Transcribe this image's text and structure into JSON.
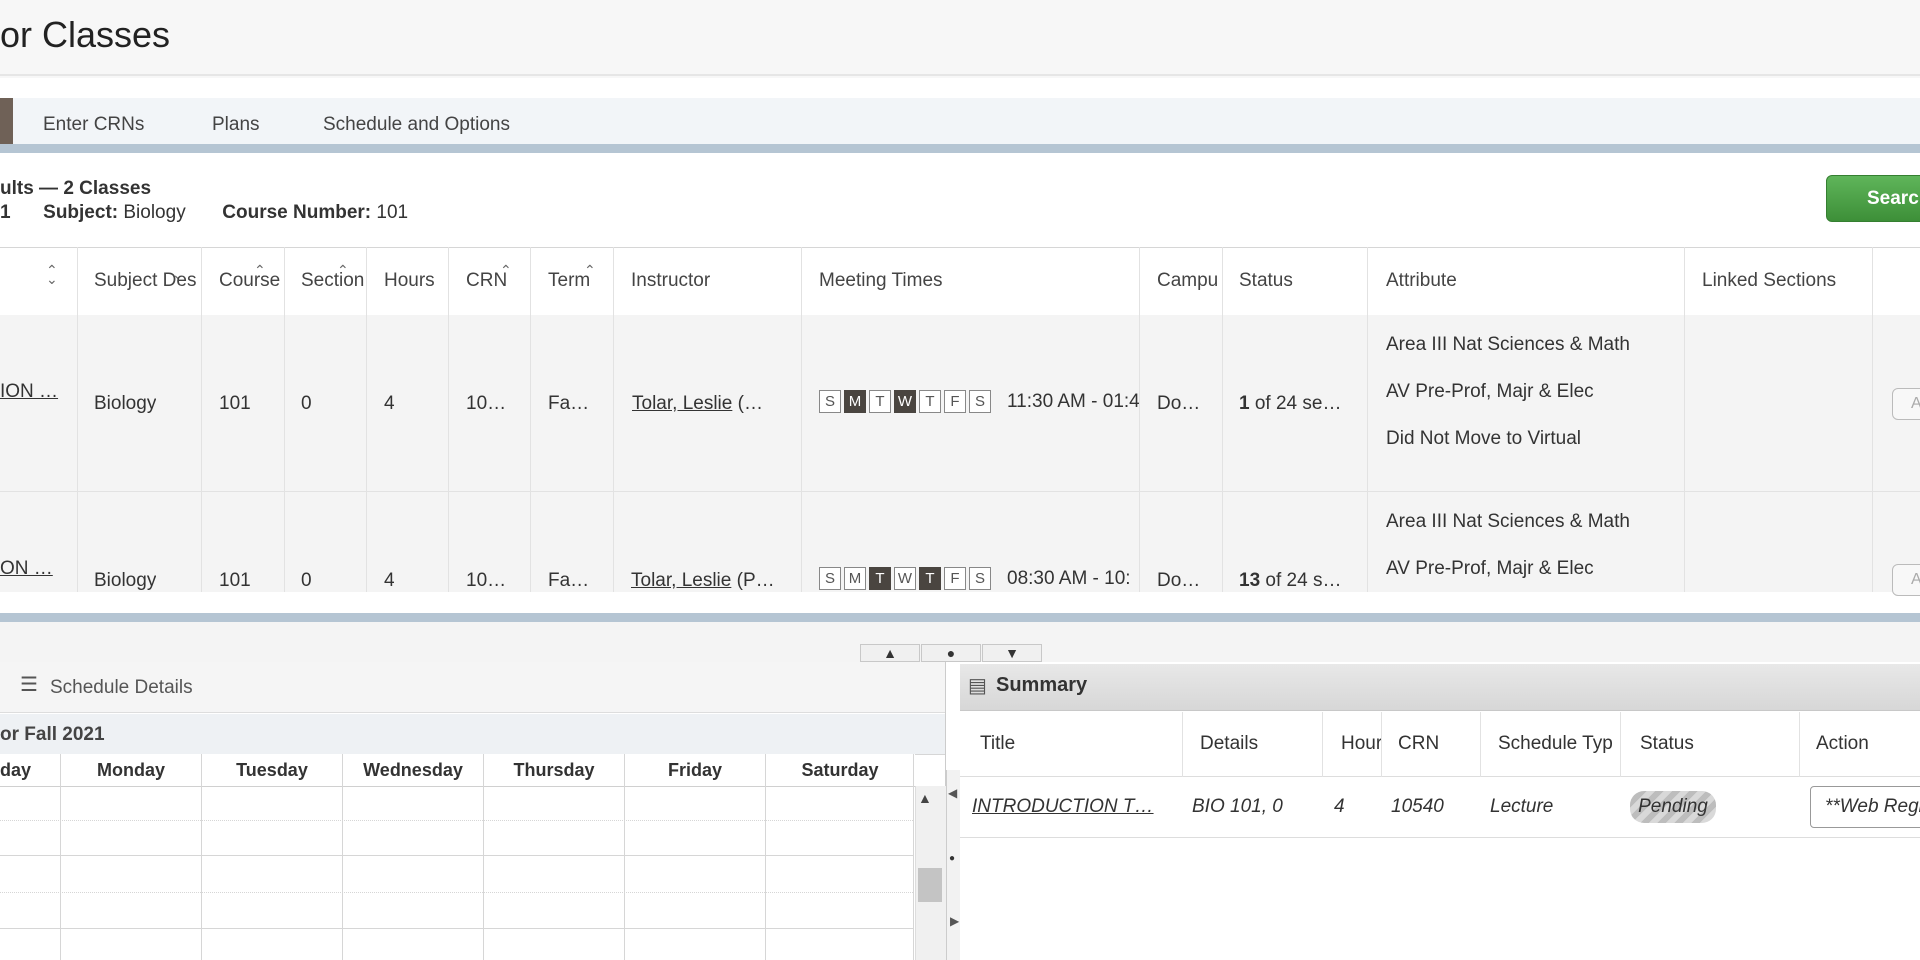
{
  "page": {
    "title": "or Classes"
  },
  "tabs": [
    {
      "label": "Enter CRNs"
    },
    {
      "label": "Plans"
    },
    {
      "label": "Schedule and Options"
    }
  ],
  "results": {
    "title": "ults — 2 Classes",
    "term_fragment": "1",
    "subject_label": "Subject:",
    "subject_value": "Biology",
    "course_number_label": "Course Number:",
    "course_number_value": "101",
    "search_button": "Searc"
  },
  "grid": {
    "columns": [
      "Subject Des",
      "Course",
      "Section",
      "Hours",
      "CRN",
      "Term",
      "Instructor",
      "Meeting Times",
      "Campu",
      "Status",
      "Attribute",
      "Linked Sections"
    ],
    "rows": [
      {
        "title": "ION …",
        "subject": "Biology",
        "course": "101",
        "section": "0",
        "hours": "4",
        "crn": "10…",
        "term": "Fa…",
        "instructor_link": "Tolar, Leslie",
        "instructor_rest": "(…",
        "days": [
          "S",
          "M",
          "T",
          "W",
          "T",
          "F",
          "S"
        ],
        "days_on": [
          false,
          true,
          false,
          true,
          false,
          false,
          false
        ],
        "time": "11:30 AM - 01:4",
        "campus": "Do…",
        "status_bold": "1",
        "status_rest": " of 24 se…",
        "attributes": [
          "Area III Nat Sciences & Math",
          "AV Pre-Prof, Majr & Elec",
          "Did Not Move to Virtual"
        ],
        "action_stub": "A"
      },
      {
        "title": "ON …",
        "subject": "Biology",
        "course": "101",
        "section": "0",
        "hours": "4",
        "crn": "10…",
        "term": "Fa…",
        "instructor_link": "Tolar, Leslie",
        "instructor_rest": "(P…",
        "days": [
          "S",
          "M",
          "T",
          "W",
          "T",
          "F",
          "S"
        ],
        "days_on": [
          false,
          false,
          true,
          false,
          true,
          false,
          false
        ],
        "time": "08:30 AM - 10:",
        "campus": "Do…",
        "status_bold": "13",
        "status_rest": " of 24 s…",
        "attributes": [
          "Area III Nat Sciences & Math",
          "AV Pre-Prof, Majr & Elec"
        ],
        "action_stub": "A"
      }
    ]
  },
  "schedule": {
    "tab_label": "Schedule Details",
    "term_label": "or Fall 2021",
    "weekdays": [
      "day",
      "Monday",
      "Tuesday",
      "Wednesday",
      "Thursday",
      "Friday",
      "Saturday"
    ]
  },
  "summary": {
    "title": "Summary",
    "columns": [
      "Title",
      "Details",
      "Hour",
      "CRN",
      "Schedule Typ",
      "Status",
      "Action"
    ],
    "row": {
      "title": "INTRODUCTION T…",
      "details": "BIO 101, 0",
      "hours": "4",
      "crn": "10540",
      "schedule_type": "Lecture",
      "status": "Pending",
      "action": "**Web Regi"
    }
  },
  "colors": {
    "accent_bar": "#b5c5d3",
    "search_green": "#4ea449",
    "active_tab": "#6f6157",
    "day_on": "#4a4540"
  }
}
